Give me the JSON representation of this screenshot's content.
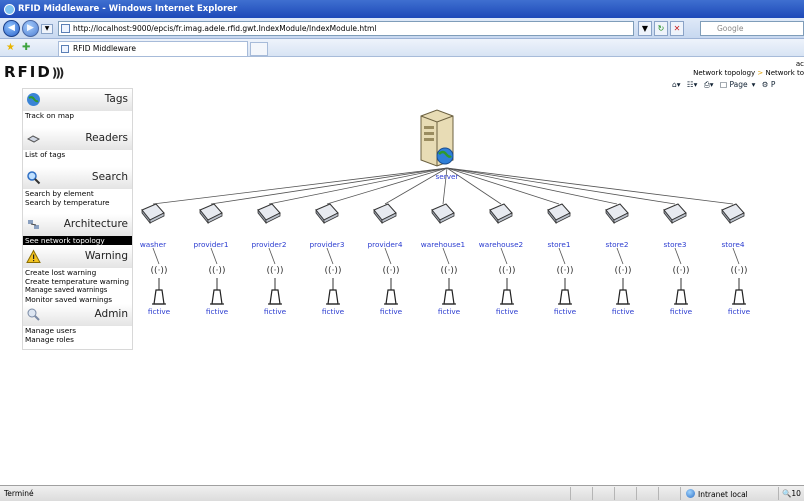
{
  "window": {
    "title": "RFID Middleware - Windows Internet Explorer"
  },
  "address": {
    "url": "http://localhost:9000/epcis/fr.imag.adele.rfid.gwt.IndexModule/IndexModule.html"
  },
  "search": {
    "placeholder": "Google"
  },
  "tab": {
    "title": "RFID Middleware"
  },
  "commandbar": {
    "page_label": "Page",
    "page_key": "P"
  },
  "header": {
    "logo": "RFID",
    "user": "ac",
    "breadcrumb_1": "Network topology",
    "breadcrumb_sep": ">",
    "breadcrumb_2": "Network to"
  },
  "sidebar": {
    "sections": [
      {
        "title": "Tags",
        "icon": "globe-icon",
        "items": [
          "Track on map"
        ]
      },
      {
        "title": "Readers",
        "icon": "reader-icon",
        "items": [
          "List of tags"
        ]
      },
      {
        "title": "Search",
        "icon": "magnifier-icon",
        "items": [
          "Search by element",
          "Search by temperature"
        ]
      },
      {
        "title": "Architecture",
        "icon": "network-icon",
        "items": [
          "See network topology"
        ],
        "active": "See network topology"
      },
      {
        "title": "Warning",
        "icon": "warning-icon",
        "items": [
          "Create lost warning",
          "Create temperature warning",
          "Manage saved warnings",
          "Monitor saved warnings"
        ]
      },
      {
        "title": "Admin",
        "icon": "admin-icon",
        "items": [
          "Manage users",
          "Manage roles"
        ]
      }
    ]
  },
  "topology": {
    "server": "server",
    "nodes": [
      {
        "name": "washer",
        "reader": "fictive"
      },
      {
        "name": "provider1",
        "reader": "fictive"
      },
      {
        "name": "provider2",
        "reader": "fictive"
      },
      {
        "name": "provider3",
        "reader": "fictive"
      },
      {
        "name": "provider4",
        "reader": "fictive"
      },
      {
        "name": "warehouse1",
        "reader": "fictive"
      },
      {
        "name": "warehouse2",
        "reader": "fictive"
      },
      {
        "name": "store1",
        "reader": "fictive"
      },
      {
        "name": "store2",
        "reader": "fictive"
      },
      {
        "name": "store3",
        "reader": "fictive"
      },
      {
        "name": "store4",
        "reader": "fictive"
      }
    ]
  },
  "status": {
    "text": "Terminé",
    "zone": "Intranet local",
    "zoom": "10"
  },
  "colors": {
    "titlebar": "#1d49b8",
    "link": "#2a3bd0",
    "active_item_bg": "#000000"
  }
}
